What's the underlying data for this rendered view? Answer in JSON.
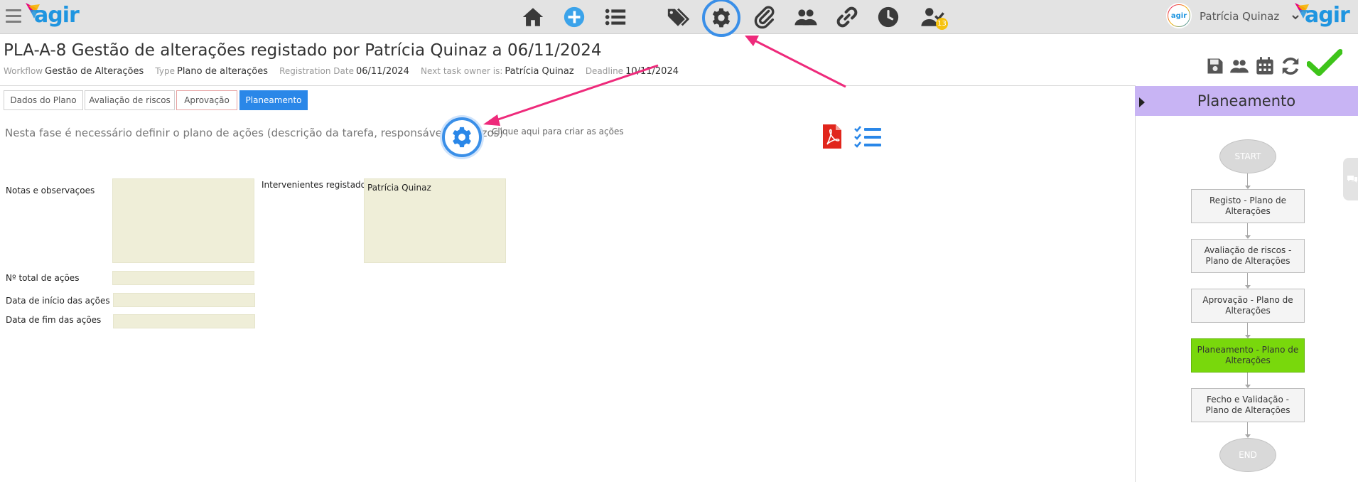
{
  "brand": {
    "logo_text": "agir",
    "colors": {
      "blue": "#1f95e0",
      "magenta": "#e6007e",
      "yellow": "#f7b500",
      "accent_blue": "#2a87e8",
      "green": "#79d80c",
      "panel_purple": "#c8b4f4"
    }
  },
  "topbar": {
    "icons": [
      "home-icon",
      "plus-circle-icon",
      "list-icon",
      "tags-icon",
      "gear-icon",
      "paperclip-icon",
      "users-icon",
      "link-icon",
      "clock-icon",
      "user-check-icon"
    ],
    "tasks_badge": "13",
    "user_name": "Patrícia Quinaz",
    "avatar_text": "agir"
  },
  "header": {
    "title": "PLA-A-8 Gestão de alterações registado por Patrícia Quinaz a 06/11/2024",
    "meta": {
      "workflow_label": "Workflow",
      "workflow_value": "Gestão de Alterações",
      "type_label": "Type",
      "type_value": "Plano de alterações",
      "registration_label": "Registration Date",
      "registration_value": "06/11/2024",
      "owner_label": "Next task owner is:",
      "owner_value": "Patrícia Quinaz",
      "deadline_label": "Deadline",
      "deadline_value": "10/11/2024"
    },
    "actions": [
      "save-icon",
      "users-icon",
      "calendar-icon",
      "refresh-icon",
      "check-icon"
    ]
  },
  "tabs": [
    {
      "label": "Dados do Plano"
    },
    {
      "label": "Avaliação de riscos"
    },
    {
      "label": "Aprovação"
    },
    {
      "label": "Planeamento",
      "active": true
    }
  ],
  "content": {
    "phase_text": "Nesta fase é necessário definir o plano de ações (descrição da tarefa, responsáveis e prazos)",
    "hint": "Clique aqui para criar as ações",
    "notes_label": "Notas e observaçoes",
    "notes_value": "",
    "participants_label": "Intervenientes registados",
    "participants_value": "Patrícia Quinaz",
    "total_actions_label": "Nº total de ações",
    "total_actions_value": "",
    "start_date_label": "Data de início das ações",
    "start_date_value": "",
    "end_date_label": "Data de fim das ações",
    "end_date_value": ""
  },
  "panel": {
    "title": "Planeamento",
    "start": "START",
    "end": "END",
    "steps": [
      {
        "label": "Registo - Plano de Alterações",
        "current": false
      },
      {
        "label": "Avaliação de riscos - Plano de Alterações",
        "current": false
      },
      {
        "label": "Aprovação - Plano de Alterações",
        "current": false
      },
      {
        "label": "Planeamento - Plano de Alterações",
        "current": true
      },
      {
        "label": "Fecho e Validação - Plano de Alterações",
        "current": false
      }
    ]
  }
}
